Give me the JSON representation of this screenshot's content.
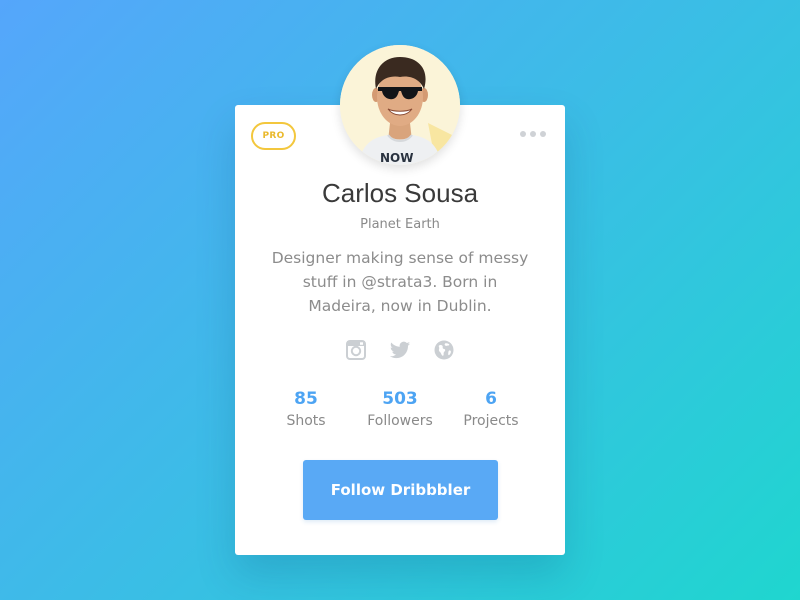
{
  "colors": {
    "accent": "#59a9f5",
    "stat_number": "#4da4f3",
    "pro_badge": "#f3c73d",
    "background_start": "#55a6fb",
    "background_end": "#1fd6cf"
  },
  "profile": {
    "badge": "PRO",
    "name": "Carlos Sousa",
    "location": "Planet Earth",
    "bio_lines": [
      "Designer making sense of messy",
      "stuff in @strata3. Born in",
      "Madeira, now in Dublin."
    ],
    "avatar_shirt_text": "NOW"
  },
  "social": [
    {
      "icon": "instagram-icon"
    },
    {
      "icon": "twitter-icon"
    },
    {
      "icon": "globe-icon"
    }
  ],
  "stats": [
    {
      "value": "85",
      "label": "Shots"
    },
    {
      "value": "503",
      "label": "Followers"
    },
    {
      "value": "6",
      "label": "Projects"
    }
  ],
  "menu": {
    "icon": "more-options-icon"
  },
  "actions": {
    "follow_label": "Follow Dribbbler"
  }
}
